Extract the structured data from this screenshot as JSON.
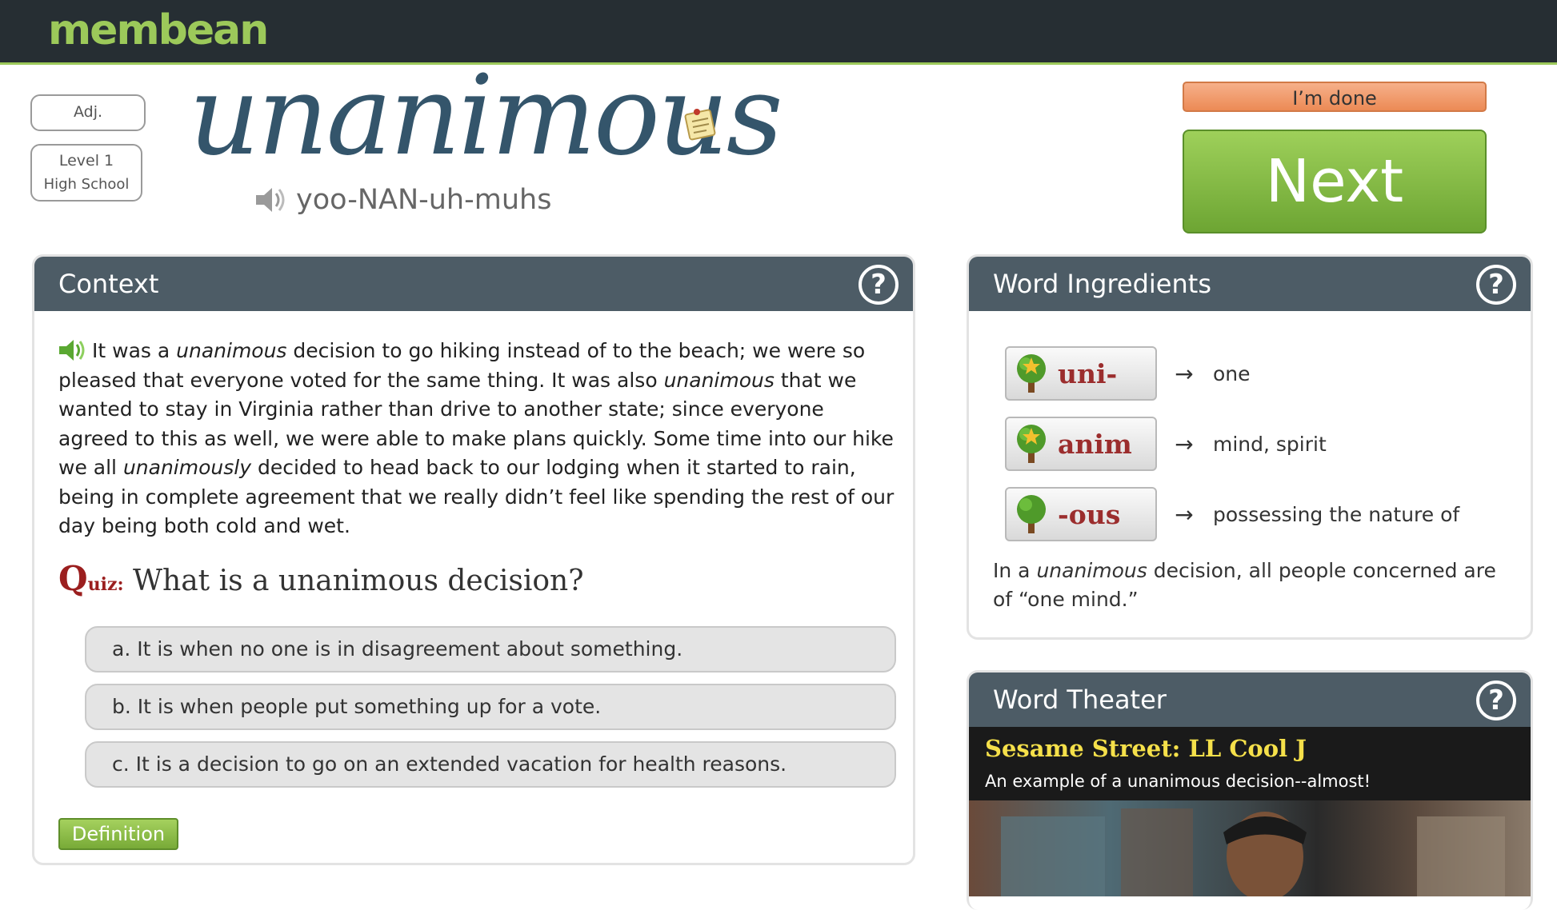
{
  "app": {
    "logo": "membean"
  },
  "word": {
    "part_of_speech": "Adj.",
    "level": "Level 1",
    "level_group": "High School",
    "headword": "unanimous",
    "pronunciation": "yoo-NAN-uh-muhs"
  },
  "actions": {
    "done_label": "I’m done",
    "next_label": "Next"
  },
  "context": {
    "title": "Context",
    "passage_1": "It was a ",
    "em_1": "unanimous",
    "passage_2": " decision to go hiking instead of to the beach; we were so pleased that everyone voted for the same thing. It was also ",
    "em_2": "unanimous",
    "passage_3": " that we wanted to stay in Virginia rather than drive to another state; since everyone agreed to this as well, we were able to make plans quickly. Some time into our hike we all ",
    "em_3": "unanimously",
    "passage_4": " decided to head back to our lodging when it started to rain, being in complete agreement that we really didn’t feel like spending the rest of our day being both cold and wet.",
    "quiz_q": "Q",
    "quiz_uiz": "uiz:",
    "quiz_question": "What is a unanimous decision?",
    "options": [
      "a. It is when no one is in disagreement about something.",
      "b. It is when people put something up for a vote.",
      "c. It is a decision to go on an extended vacation for health reasons."
    ],
    "definition_label": "Definition"
  },
  "ingredients": {
    "title": "Word Ingredients",
    "items": [
      {
        "part": "uni-",
        "meaning": "one"
      },
      {
        "part": "anim",
        "meaning": "mind, spirit"
      },
      {
        "part": "-ous",
        "meaning": "possessing the nature of"
      }
    ],
    "arrow": "→",
    "note_1": "In a ",
    "note_em": "unanimous",
    "note_2": " decision, all people concerned are of “one mind.”"
  },
  "theater": {
    "title": "Word Theater",
    "clip_title": "Sesame Street: LL Cool J",
    "clip_subtitle": "An example of a unanimous decision--almost!"
  },
  "help_symbol": "?",
  "colors": {
    "accent_green": "#7ab13b",
    "header_slate": "#4d5c66",
    "done_orange": "#f0935e",
    "title_blue": "#34556b"
  },
  "icons": [
    "notepad-icon",
    "speaker-icon",
    "help-icon",
    "tree-icon"
  ]
}
